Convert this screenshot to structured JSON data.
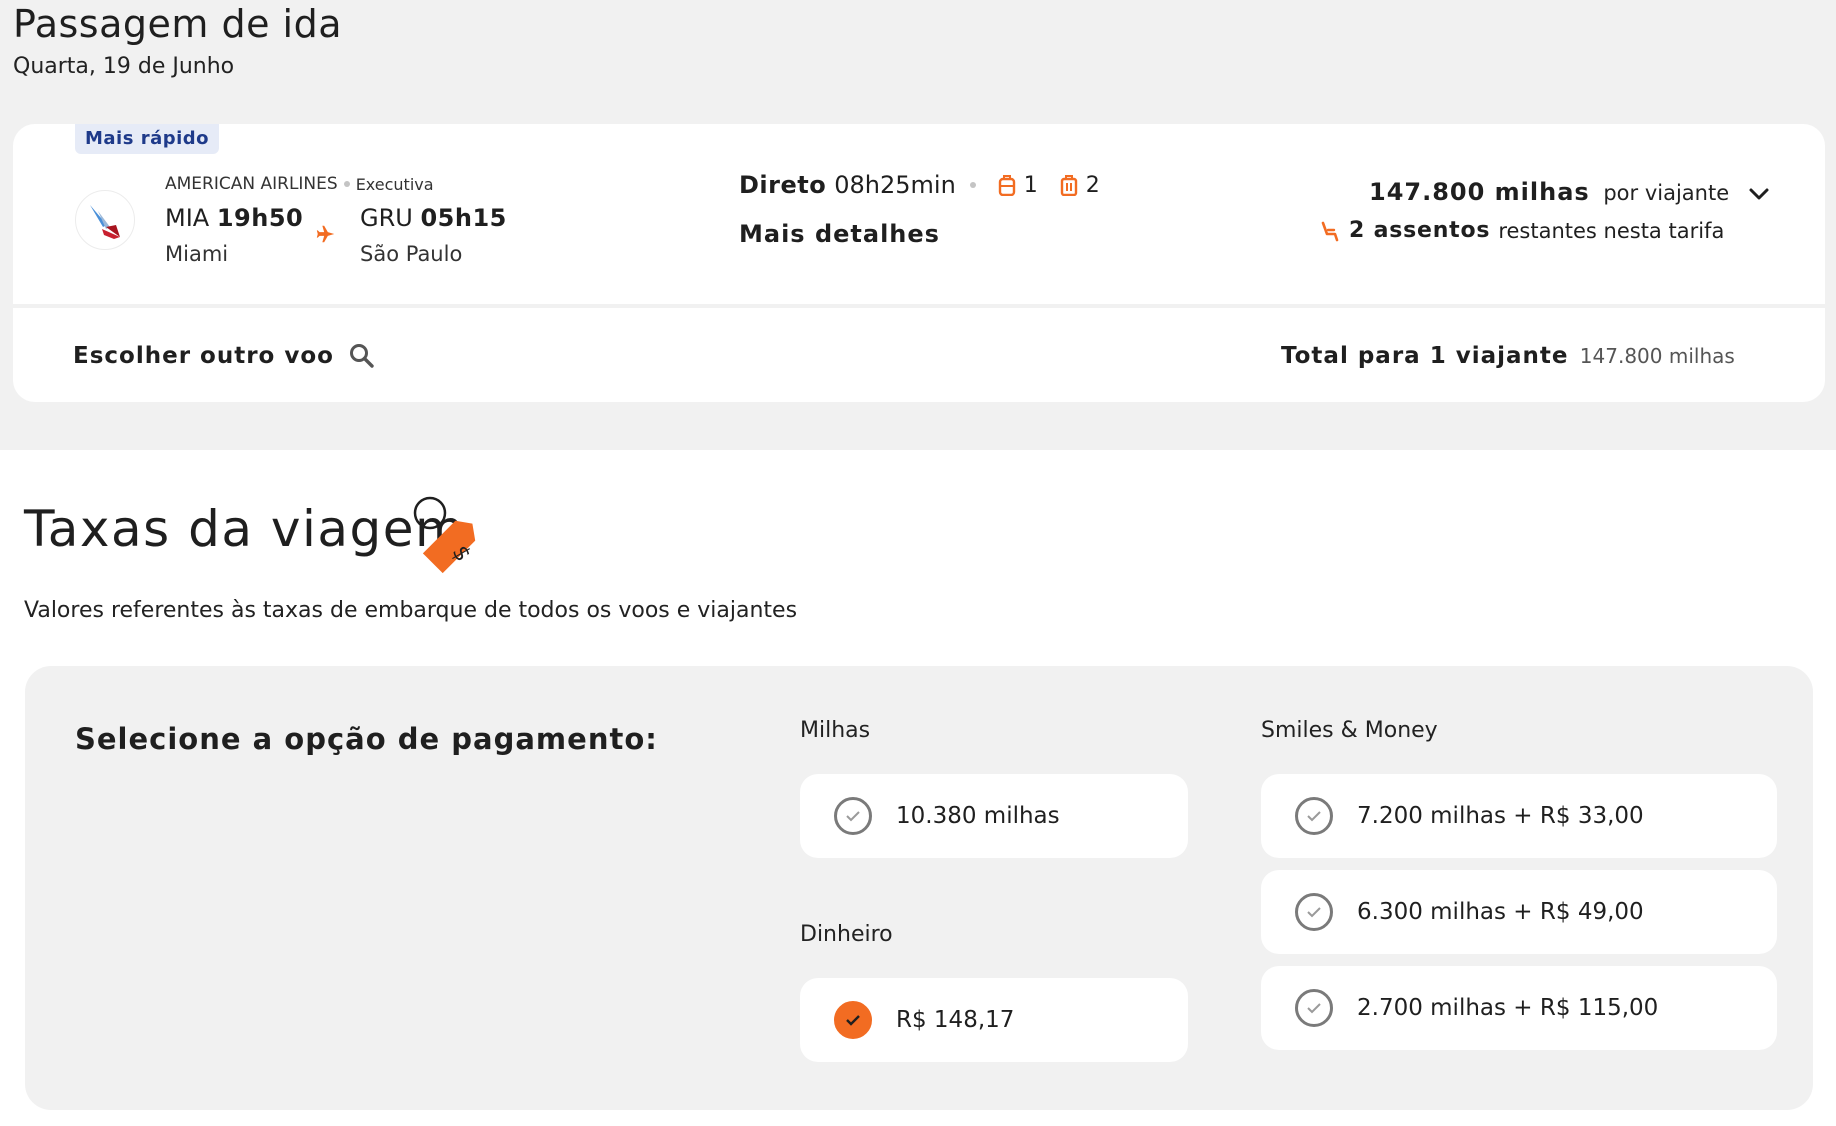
{
  "header": {
    "title": "Passagem de ida",
    "date": "Quarta, 19 de Junho"
  },
  "flight": {
    "badge": "Mais rápido",
    "airline": "AMERICAN AIRLINES",
    "cabin": "Executiva",
    "origin_code": "MIA",
    "origin_time": "19h50",
    "origin_city": "Miami",
    "dest_code": "GRU",
    "dest_time": "05h15",
    "dest_city": "São Paulo",
    "stops_label": "Direto",
    "duration": "08h25min",
    "carry_on_count": "1",
    "checked_bag_count": "2",
    "details_label": "Mais detalhes",
    "price": "147.800 milhas",
    "price_suffix": "por viajante",
    "seats_bold": "2 assentos",
    "seats_rest": "restantes nesta tarifa",
    "other_flight_label": "Escolher outro voo",
    "total_label": "Total para 1 viajante",
    "total_value": "147.800 milhas"
  },
  "fees": {
    "title": "Taxas da viagem",
    "subtitle": "Valores referentes às taxas de embarque de todos os voos e viajantes",
    "select_label": "Selecione a opção de pagamento:",
    "miles_group": "Milhas",
    "cash_group": "Dinheiro",
    "smiles_money_group": "Smiles & Money",
    "miles_option": "10.380 milhas",
    "cash_option": "R$ 148,17",
    "sm_options": [
      "7.200 milhas + R$ 33,00",
      "6.300 milhas + R$ 49,00",
      "2.700 milhas + R$ 115,00"
    ]
  },
  "colors": {
    "accent": "#f26c22",
    "badge_bg": "#e6ebf7",
    "badge_text": "#1e3a8a",
    "panel_bg": "#f1f1f1"
  },
  "icons": [
    "american-airlines-logo",
    "plane-icon",
    "backpack-icon",
    "suitcase-icon",
    "seat-icon",
    "chevron-down-icon",
    "search-icon",
    "price-tag-icon",
    "check-icon"
  ]
}
